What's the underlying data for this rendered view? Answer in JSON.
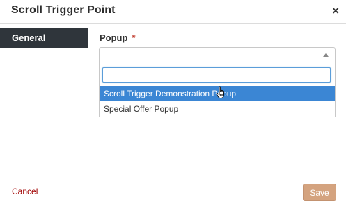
{
  "modal": {
    "title": "Scroll Trigger Point",
    "close_glyph": "×"
  },
  "tabs": [
    {
      "label": "General",
      "active": true
    }
  ],
  "field": {
    "label": "Popup",
    "required_marker": "*",
    "selected_value": "",
    "search_value": "",
    "options": [
      {
        "label": "Scroll Trigger Demonstration Popup",
        "highlighted": true
      },
      {
        "label": "Special Offer Popup",
        "highlighted": false
      }
    ]
  },
  "footer": {
    "cancel_label": "Cancel",
    "save_label": "Save"
  },
  "colors": {
    "tab_active_bg": "#2f353b",
    "option_highlight": "#3b86d4",
    "cancel_text": "#a00000",
    "save_bg": "#d4a37f",
    "required": "#c0392b"
  },
  "icons": {
    "close": "close-icon",
    "dropdown_arrow": "caret-up-icon",
    "cursor": "hand-pointer-icon"
  }
}
